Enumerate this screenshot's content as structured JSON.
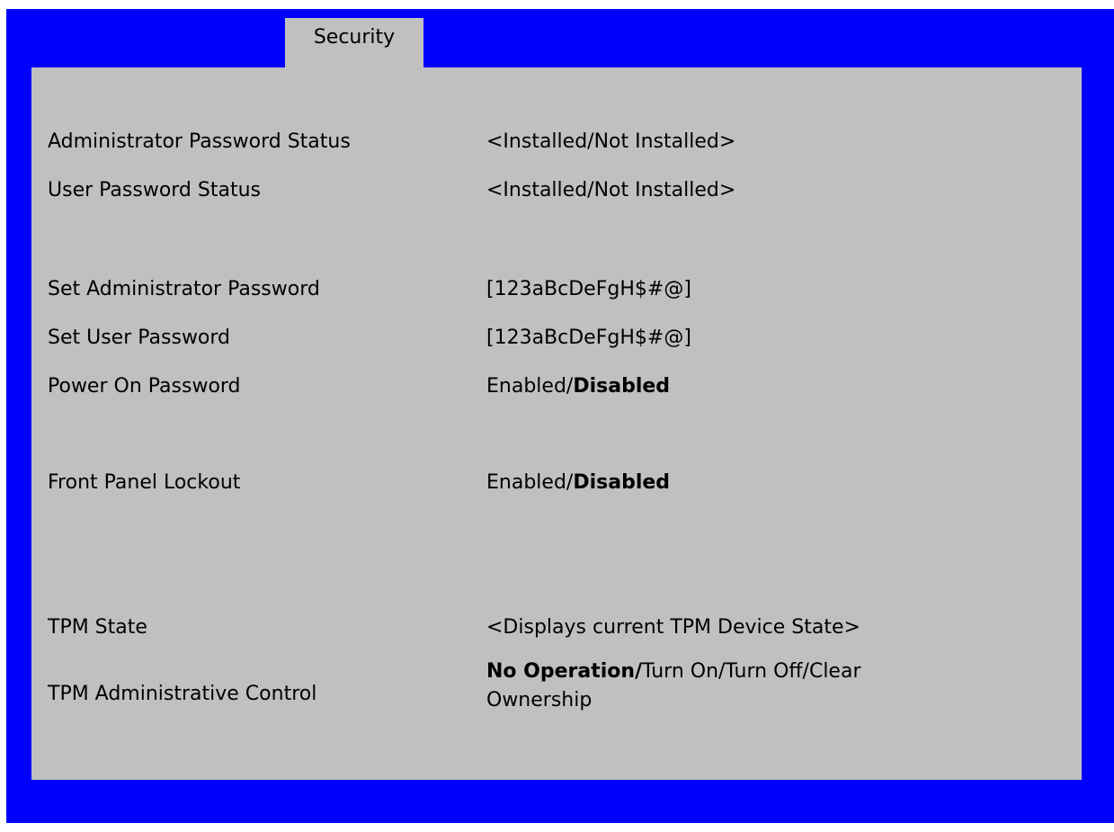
{
  "tab": {
    "label": "Security"
  },
  "rows": {
    "admin_status": {
      "label": "Administrator Password Status",
      "value": "<Installed/Not Installed>"
    },
    "user_status": {
      "label": "User Password Status",
      "value": "<Installed/Not Installed>"
    },
    "set_admin": {
      "label": "Set Administrator Password",
      "value": "[123aBcDeFgH$#@]"
    },
    "set_user": {
      "label": "Set User Password",
      "value": "[123aBcDeFgH$#@]"
    },
    "power_on": {
      "label": "Power On Password",
      "option_a": "Enabled/",
      "option_b": "Disabled"
    },
    "front_panel": {
      "label": "Front Panel Lockout",
      "option_a": "Enabled/",
      "option_b": "Disabled"
    },
    "tpm_state": {
      "label": "TPM State",
      "value": "<Displays current TPM Device State>"
    },
    "tpm_admin": {
      "label": "TPM Administrative Control",
      "option_bold": "No Operation/",
      "option_rest": "Turn On/Turn Off/Clear Ownership"
    }
  },
  "colors": {
    "frame": "#0000ff",
    "panel": "#c0c0c0",
    "text": "#000000"
  }
}
